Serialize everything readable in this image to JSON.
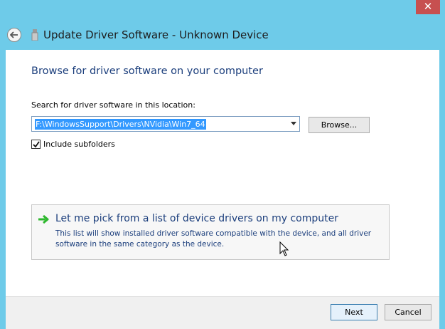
{
  "window": {
    "title": "Update Driver Software - Unknown Device",
    "close_label": "✕"
  },
  "main": {
    "heading": "Browse for driver software on your computer",
    "search_label": "Search for driver software in this location:",
    "location_value": "F:\\WindowsSupport\\Drivers\\NVidia\\Win7_64",
    "browse_label": "Browse...",
    "include_subfolders_label": "Include subfolders",
    "include_subfolders_checked": true,
    "pick_title": "Let me pick from a list of device drivers on my computer",
    "pick_description": "This list will show installed driver software compatible with the device, and all driver software in the same category as the device."
  },
  "footer": {
    "next_label": "Next",
    "cancel_label": "Cancel"
  },
  "colors": {
    "frame": "#6ecbe9",
    "heading": "#1b3e7c",
    "close": "#c75050",
    "selection": "#3399ff",
    "arrow": "#2eb82e"
  },
  "icons": {
    "back": "back-arrow-icon",
    "device": "usb-device-icon",
    "pick": "green-arrow-icon",
    "check": "checkmark-icon",
    "cursor": "mouse-pointer-icon"
  }
}
